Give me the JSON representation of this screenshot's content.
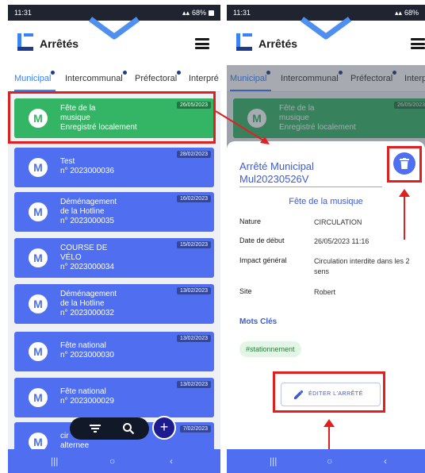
{
  "status": {
    "time": "11:31",
    "battery": "68%"
  },
  "app": {
    "title": "Arrêtés"
  },
  "tabs": [
    "Municipal",
    "Intercommunal",
    "Préfectoral",
    "Interpré"
  ],
  "list": [
    {
      "avatar": "M",
      "line1": "Fête  de la",
      "line2": "musique",
      "line3": "Enregistré localement",
      "date": "26/05/2023",
      "color": "#34b566"
    },
    {
      "avatar": "M",
      "line1": "Test",
      "line2": "n° 2023000036",
      "line3": "",
      "date": "28/02/2023",
      "color": "#4f6ff0"
    },
    {
      "avatar": "M",
      "line1": "Déménagement",
      "line2": "de la Hotline",
      "line3": "n° 2023000035",
      "date": "16/02/2023",
      "color": "#4f6ff0"
    },
    {
      "avatar": "M",
      "line1": "COURSE DE",
      "line2": "VÉLO",
      "line3": "n° 2023000034",
      "date": "15/02/2023",
      "color": "#4f6ff0"
    },
    {
      "avatar": "M",
      "line1": "Déménagement",
      "line2": "de la Hotline",
      "line3": "n° 2023000032",
      "date": "13/02/2023",
      "color": "#4f6ff0"
    },
    {
      "avatar": "M",
      "line1": "Fête national",
      "line2": "n° 2023000030",
      "line3": "",
      "date": "13/02/2023",
      "color": "#4f6ff0"
    },
    {
      "avatar": "M",
      "line1": "Fête national",
      "line2": "n° 2023000029",
      "line3": "",
      "date": "13/02/2023",
      "color": "#4f6ff0"
    },
    {
      "avatar": "M",
      "line1": "cir",
      "line2": "alternee",
      "line3": "",
      "date": "7/02/2023",
      "color": "#4f6ff0"
    }
  ],
  "detail": {
    "title_line1": "Arrêté Municipal",
    "title_line2": "Mul20230526V",
    "subtitle": "Fête  de la musique",
    "rows": [
      {
        "label": "Nature",
        "value": "CIRCULATION"
      },
      {
        "label": "Date de début",
        "value": "26/05/2023 11:16"
      },
      {
        "label": "Impact général",
        "value": "Circulation interdite dans les 2 sens"
      },
      {
        "label": "Site",
        "value": "Robert"
      }
    ],
    "keywords_label": "Mots Clés",
    "keyword_chip": "#stationnement",
    "edit_button": "ÉDITER L'ARRÊTÉ"
  },
  "icons": {
    "trash": "trash-icon",
    "edit": "pencil-icon",
    "filter": "filter-icon",
    "search": "search-icon",
    "add": "plus-icon",
    "menu": "hamburger-icon"
  },
  "colors": {
    "accent": "#4f6ff0",
    "success": "#34b566",
    "highlight": "#e02020"
  }
}
